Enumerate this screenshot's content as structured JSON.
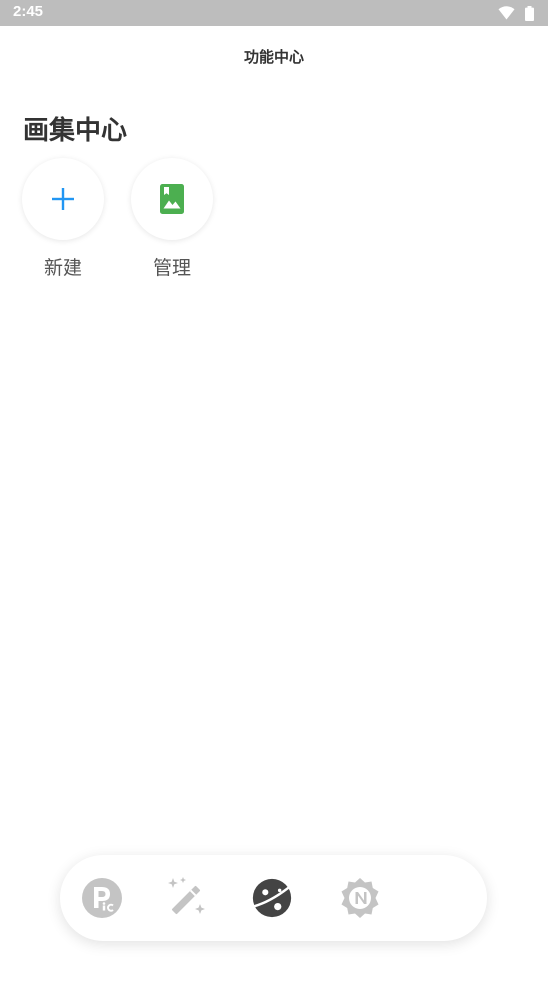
{
  "status_bar": {
    "time": "2:45",
    "icons": [
      "wifi-icon",
      "battery-icon"
    ]
  },
  "header": {
    "title": "功能中心"
  },
  "album_center": {
    "title": "画集中心",
    "actions": [
      {
        "label": "新建",
        "icon": "plus-icon",
        "color": "#2196F3"
      },
      {
        "label": "管理",
        "icon": "photo-album-icon",
        "color": "#4CAF50"
      }
    ]
  },
  "bottom_nav": {
    "items": [
      {
        "icon": "pic-logo-icon",
        "active": false
      },
      {
        "icon": "magic-wand-icon",
        "active": false
      },
      {
        "icon": "planet-icon",
        "active": true
      },
      {
        "icon": "n-badge-icon",
        "active": false
      }
    ],
    "active_color": "#444444",
    "inactive_color": "#bdbdbd"
  }
}
